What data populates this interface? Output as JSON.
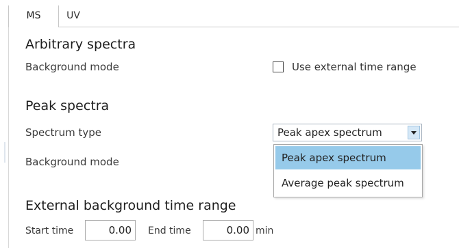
{
  "tabs": [
    {
      "label": "MS",
      "active": true
    },
    {
      "label": "UV",
      "active": false
    }
  ],
  "arbitrary": {
    "heading": "Arbitrary spectra",
    "background_mode_label": "Background mode",
    "use_external_label": "Use external time range",
    "use_external_checked": false
  },
  "peak": {
    "heading": "Peak spectra",
    "spectrum_type_label": "Spectrum type",
    "spectrum_type_value": "Peak apex spectrum",
    "spectrum_type_options": [
      "Peak apex spectrum",
      "Average peak spectrum"
    ],
    "background_mode_label": "Background mode"
  },
  "external": {
    "heading": "External background time range",
    "start_label": "Start time",
    "start_value": "0.00",
    "end_label": "End time",
    "end_value": "0.00",
    "unit": "min"
  },
  "colors": {
    "selected_option": "#96caea",
    "dropdown_button": "#d5e8f7"
  },
  "icons": {
    "combo_arrow": "triangle-down-icon"
  }
}
